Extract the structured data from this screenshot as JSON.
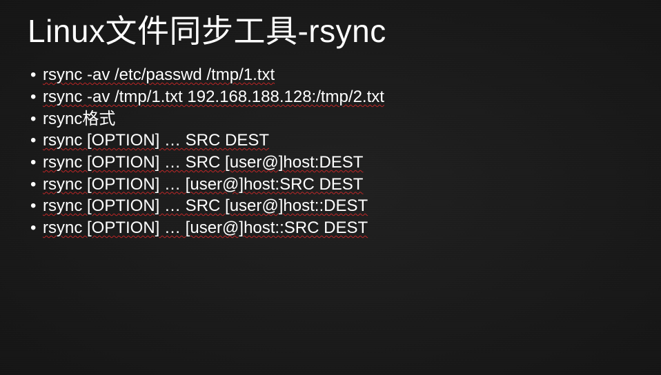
{
  "slide": {
    "title": "Linux文件同步工具-rsync",
    "bullets": [
      "rsync -av /etc/passwd /tmp/1.txt",
      "rsync -av /tmp/1.txt 192.168.188.128:/tmp/2.txt",
      "rsync格式",
      "rsync [OPTION] … SRC   DEST",
      "rsync [OPTION] … SRC   [user@]host:DEST",
      "rsync [OPTION] … [user@]host:SRC   DEST",
      "rsync [OPTION] … SRC   [user@]host::DEST",
      "rsync [OPTION] … [user@]host::SRC   DEST"
    ]
  }
}
